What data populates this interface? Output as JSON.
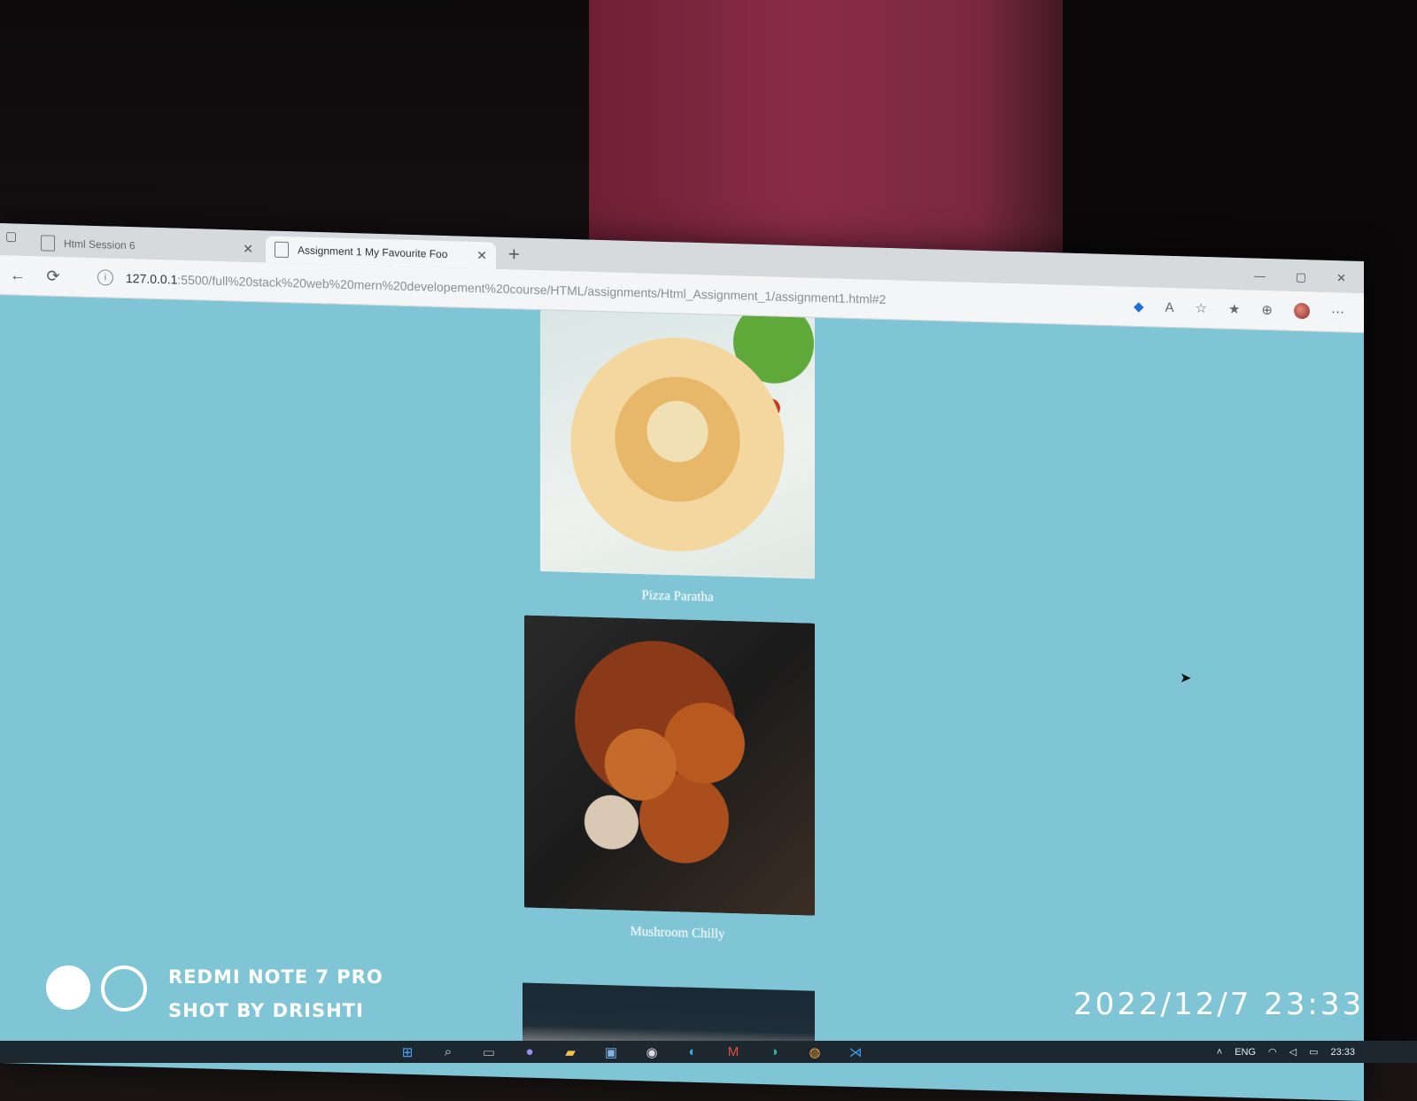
{
  "browser": {
    "tabs": [
      {
        "title": "Html Session 6",
        "active": false
      },
      {
        "title": "Assignment 1 My Favourite Foo",
        "active": true
      }
    ],
    "url_host": "127.0.0.1",
    "url_rest": ":5500/full%20stack%20web%20mern%20developement%20course/HTML/assignments/Html_Assignment_1/assignment1.html#2"
  },
  "foods": [
    {
      "caption": "Pizza Paratha"
    },
    {
      "caption": "Mushroom Chilly"
    }
  ],
  "taskbar": {
    "lang": "ENG",
    "time": "23:33"
  },
  "watermark": {
    "device": "REDMI NOTE 7 PRO",
    "shot_by": "SHOT BY DRISHTI",
    "datetime": "2022/12/7 23:33"
  },
  "colors": {
    "page_background": "#7fc5d6",
    "caption_text": "#f3fbff"
  }
}
